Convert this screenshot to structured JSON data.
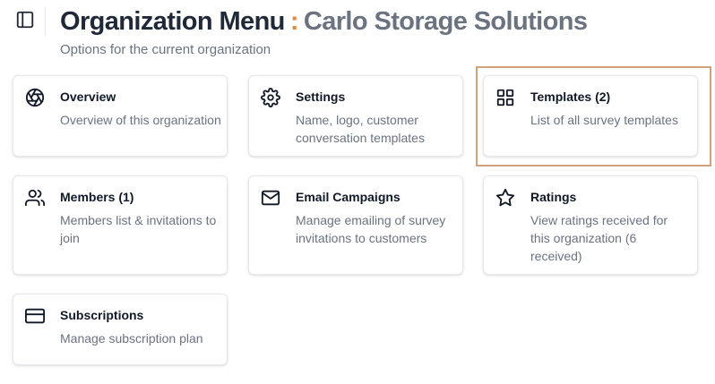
{
  "header": {
    "title": "Organization Menu",
    "separator": ":",
    "org_name": "Carlo Storage Solutions",
    "subtitle": "Options for the current organization",
    "sidebar_toggle_icon": "sidebar-toggle-icon"
  },
  "cards": [
    {
      "title": "Overview",
      "description": "Overview of this organization",
      "icon": "aperture-icon"
    },
    {
      "title": "Settings",
      "description": "Name, logo, customer conversation templates",
      "icon": "gear-icon"
    },
    {
      "title": "Templates (2)",
      "description": "List of all survey templates",
      "icon": "grid-icon"
    },
    {
      "title": "Members (1)",
      "description": "Members list & invitations to join",
      "icon": "users-icon"
    },
    {
      "title": "Email Campaigns",
      "description": "Manage emailing of survey invitations to customers",
      "icon": "mail-icon"
    },
    {
      "title": "Ratings",
      "description": "View ratings received for this organization (6 received)",
      "icon": "star-icon"
    },
    {
      "title": "Subscriptions",
      "description": "Manage subscription plan",
      "icon": "credit-card-icon"
    }
  ],
  "colors": {
    "accent": "#e08a3c",
    "highlight_border": "#d4a27a",
    "muted_text": "#6b7280"
  }
}
